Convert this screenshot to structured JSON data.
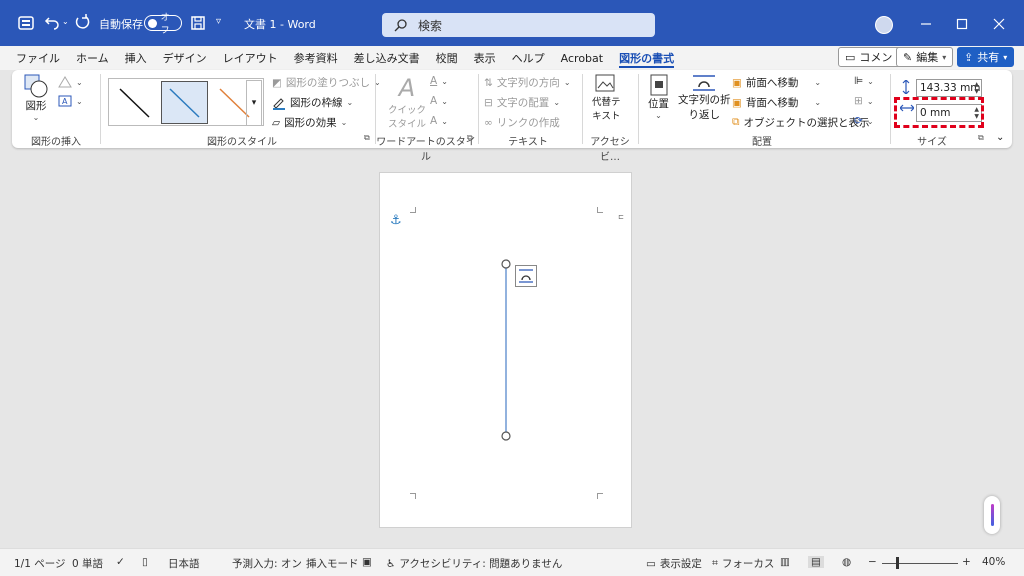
{
  "titlebar": {
    "autosave_label": "自動保存",
    "autosave_state": "オフ",
    "doc_title": "文書 1  -  Word",
    "search_placeholder": "検索"
  },
  "tabs": [
    "ファイル",
    "ホーム",
    "挿入",
    "デザイン",
    "レイアウト",
    "参考資料",
    "差し込み文書",
    "校閲",
    "表示",
    "ヘルプ",
    "Acrobat",
    "図形の書式"
  ],
  "tab_actions": {
    "comment": "コメント",
    "edit": "編集",
    "share": "共有"
  },
  "ribbon": {
    "insert_shapes": {
      "shape_label": "図形",
      "group": "図形の挿入"
    },
    "shape_styles": {
      "fill": "図形の塗りつぶし",
      "outline": "図形の枠線",
      "effects": "図形の効果",
      "group": "図形のスタイル"
    },
    "wordart": {
      "quick_style_line1": "クイック",
      "quick_style_line2": "スタイル",
      "group": "ワードアートのスタイル"
    },
    "text": {
      "direction": "文字列の方向",
      "align": "文字の配置",
      "link": "リンクの作成",
      "group": "テキスト"
    },
    "accessibility": {
      "alt_text_line1": "代替テ",
      "alt_text_line2": "キスト",
      "group": "アクセシビ…"
    },
    "arrange": {
      "position": "位置",
      "wrap_line1": "文字列の折",
      "wrap_line2": "り返し",
      "bring_forward": "前面へ移動",
      "send_backward": "背面へ移動",
      "selection_pane": "オブジェクトの選択と表示",
      "group": "配置"
    },
    "size": {
      "height": "143.33 mm",
      "width": "0 mm",
      "group": "サイズ"
    }
  },
  "status": {
    "page": "1/1 ページ",
    "words": "0 単語",
    "language": "日本語",
    "predictive": "予測入力: オン",
    "insert_mode": "挿入モード",
    "accessibility": "アクセシビリティ: 問題ありません",
    "display_settings": "表示設定",
    "focus": "フォーカス",
    "zoom": "40%"
  },
  "colors": {
    "titlebar": "#2b57b8",
    "accent": "#1a4fb5",
    "highlight": "#e0001b"
  }
}
